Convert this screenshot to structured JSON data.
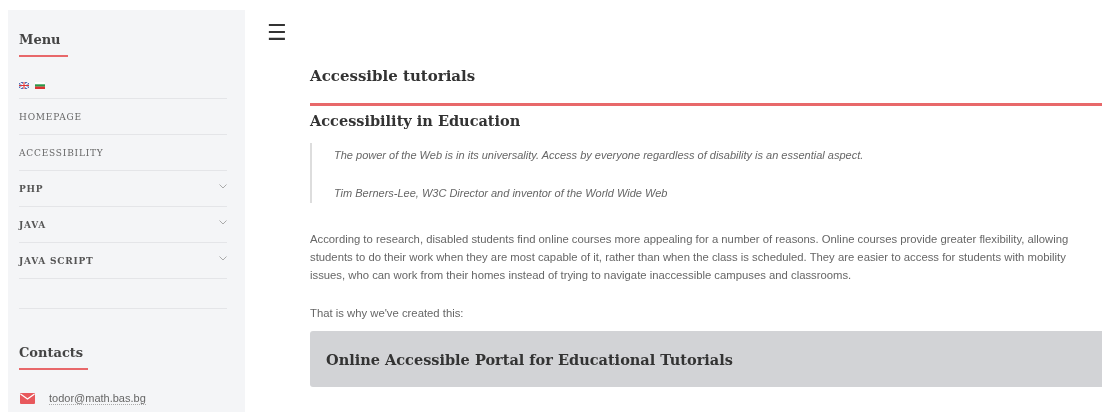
{
  "sidebar": {
    "title": "Menu",
    "items": [
      {
        "label": "HOMEPAGE",
        "has_submenu": false
      },
      {
        "label": "ACCESSIBILITY",
        "has_submenu": false
      },
      {
        "label": "PHP",
        "has_submenu": true
      },
      {
        "label": "JAVA",
        "has_submenu": true
      },
      {
        "label": "JAVA SCRIPT",
        "has_submenu": true
      }
    ],
    "contacts_title": "Contacts",
    "email": "todor@math.bas.bg"
  },
  "menu_icon": "☰",
  "main": {
    "title": "Accessible tutorials",
    "heading": "Accessibility in Education",
    "quote": "The power of the Web is in its universality. Access by everyone regardless of disability is an essential aspect.",
    "quote_author": "Tim Berners-Lee, W3C Director and inventor of the World Wide Web",
    "paragraph": "According to research, disabled students find online courses more appealing for a number of reasons. Online courses provide greater flexibility, allowing students to do their work when they are most capable of it, rather than when the class is scheduled. They are easier to access for students with mobility issues, who can work from their homes instead of trying to navigate inaccessible campuses and classrooms.",
    "lead": "That is why we've created this:",
    "banner": "Online Accessible Portal for Educational Tutorials"
  }
}
